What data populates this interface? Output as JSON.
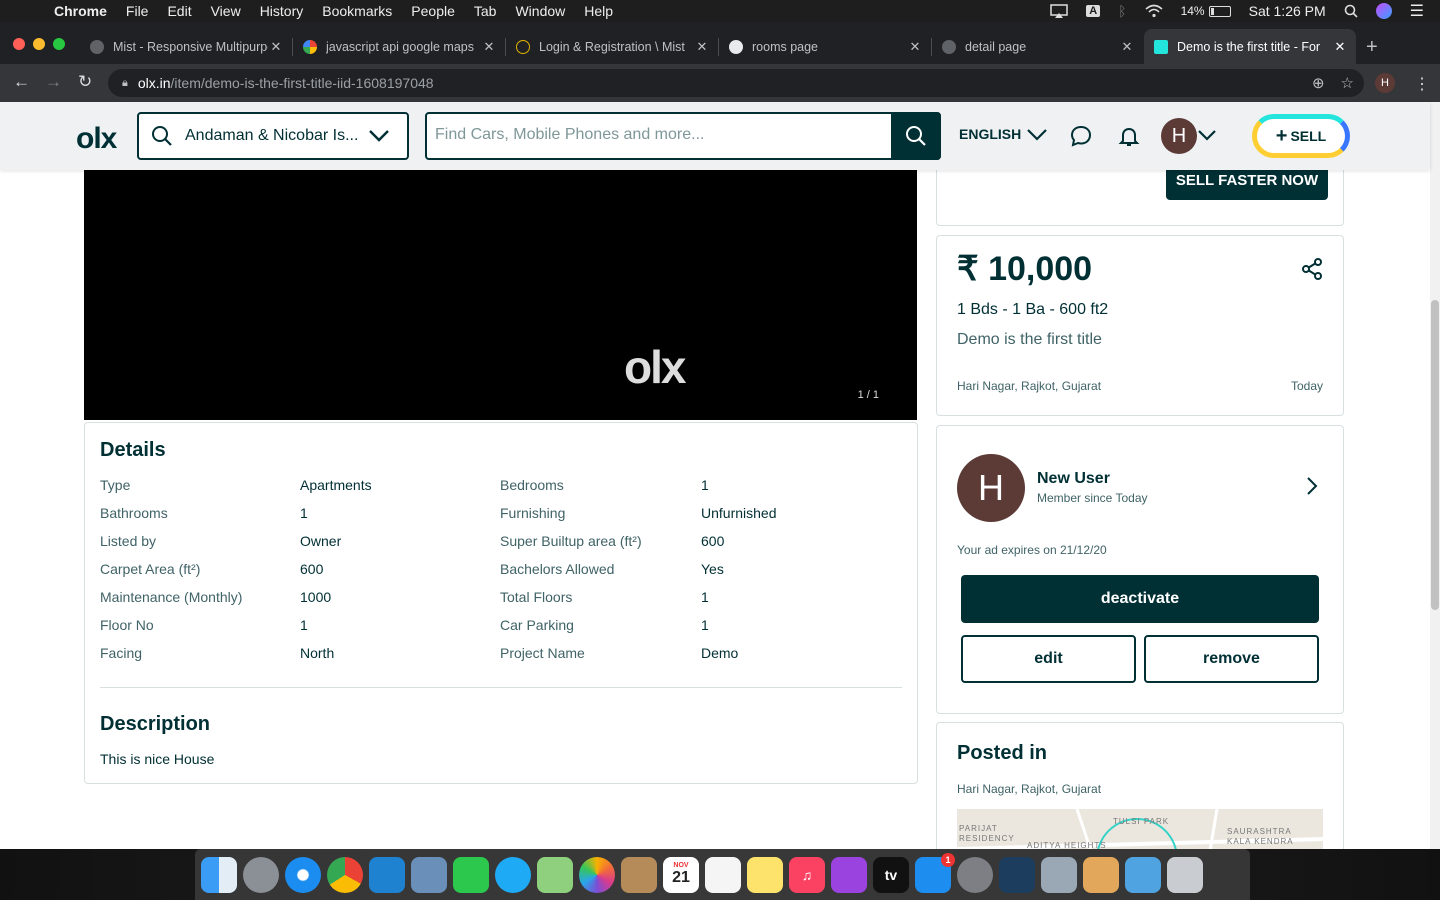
{
  "menubar": {
    "items": [
      "Chrome",
      "File",
      "Edit",
      "View",
      "History",
      "Bookmarks",
      "People",
      "Tab",
      "Window",
      "Help"
    ],
    "battery": "14%",
    "clock": "Sat 1:26 PM",
    "input_badge": "A"
  },
  "tabs": [
    {
      "title": "Mist - Responsive Multipurpose"
    },
    {
      "title": "javascript api google maps"
    },
    {
      "title": "Login & Registration \\ Mist"
    },
    {
      "title": "rooms page"
    },
    {
      "title": "detail page"
    },
    {
      "title": "Demo is the first title - For"
    }
  ],
  "address": {
    "host": "olx.in",
    "path": "/item/demo-is-the-first-title-iid-1608197048",
    "profile_initial": "H"
  },
  "header": {
    "logo": "olx",
    "location": "Andaman & Nicobar Is...",
    "search_placeholder": "Find Cars, Mobile Phones and more...",
    "language": "ENGLISH",
    "avatar_initial": "H",
    "sell_label": "SELL"
  },
  "gallery": {
    "watermark": "olx",
    "counter": "1 / 1"
  },
  "details": {
    "heading": "Details",
    "rows": [
      {
        "k1": "Type",
        "v1": "Apartments",
        "k2": "Bedrooms",
        "v2": "1"
      },
      {
        "k1": "Bathrooms",
        "v1": "1",
        "k2": "Furnishing",
        "v2": "Unfurnished"
      },
      {
        "k1": "Listed by",
        "v1": "Owner",
        "k2": "Super Builtup area (ft²)",
        "v2": "600"
      },
      {
        "k1": "Carpet Area (ft²)",
        "v1": "600",
        "k2": "Bachelors Allowed",
        "v2": "Yes"
      },
      {
        "k1": "Maintenance (Monthly)",
        "v1": "1000",
        "k2": "Total Floors",
        "v2": "1"
      },
      {
        "k1": "Floor No",
        "v1": "1",
        "k2": "Car Parking",
        "v2": "1"
      },
      {
        "k1": "Facing",
        "v1": "North",
        "k2": "Project Name",
        "v2": "Demo"
      }
    ],
    "description_heading": "Description",
    "description": "This is nice House"
  },
  "promo": {
    "sell_faster": "SELL FASTER NOW"
  },
  "price_card": {
    "price": "₹ 10,000",
    "beds": "1 Bds - 1 Ba - 600 ft2",
    "title": "Demo is the first title",
    "location": "Hari Nagar, Rajkot, Gujarat",
    "date": "Today"
  },
  "seller": {
    "initial": "H",
    "name": "New User",
    "since": "Member since Today",
    "expires": "Your ad expires on 21/12/20",
    "deactivate": "deactivate",
    "edit": "edit",
    "remove": "remove"
  },
  "posted": {
    "heading": "Posted in",
    "location": "Hari Nagar, Rajkot, Gujarat",
    "map_labels": [
      "TULSI PARK",
      "PARIJAT RESIDENCY",
      "SAURASHTRA KALA KENDRA",
      "ADITYA HEIGHTS"
    ]
  },
  "dock": {
    "calendar_month": "NOV",
    "calendar_day": "21",
    "appstore_badge": "1",
    "tv_label": "tv"
  },
  "colors": {
    "brand": "#002f34",
    "muted": "#406367",
    "avatar": "#5c3a36"
  }
}
